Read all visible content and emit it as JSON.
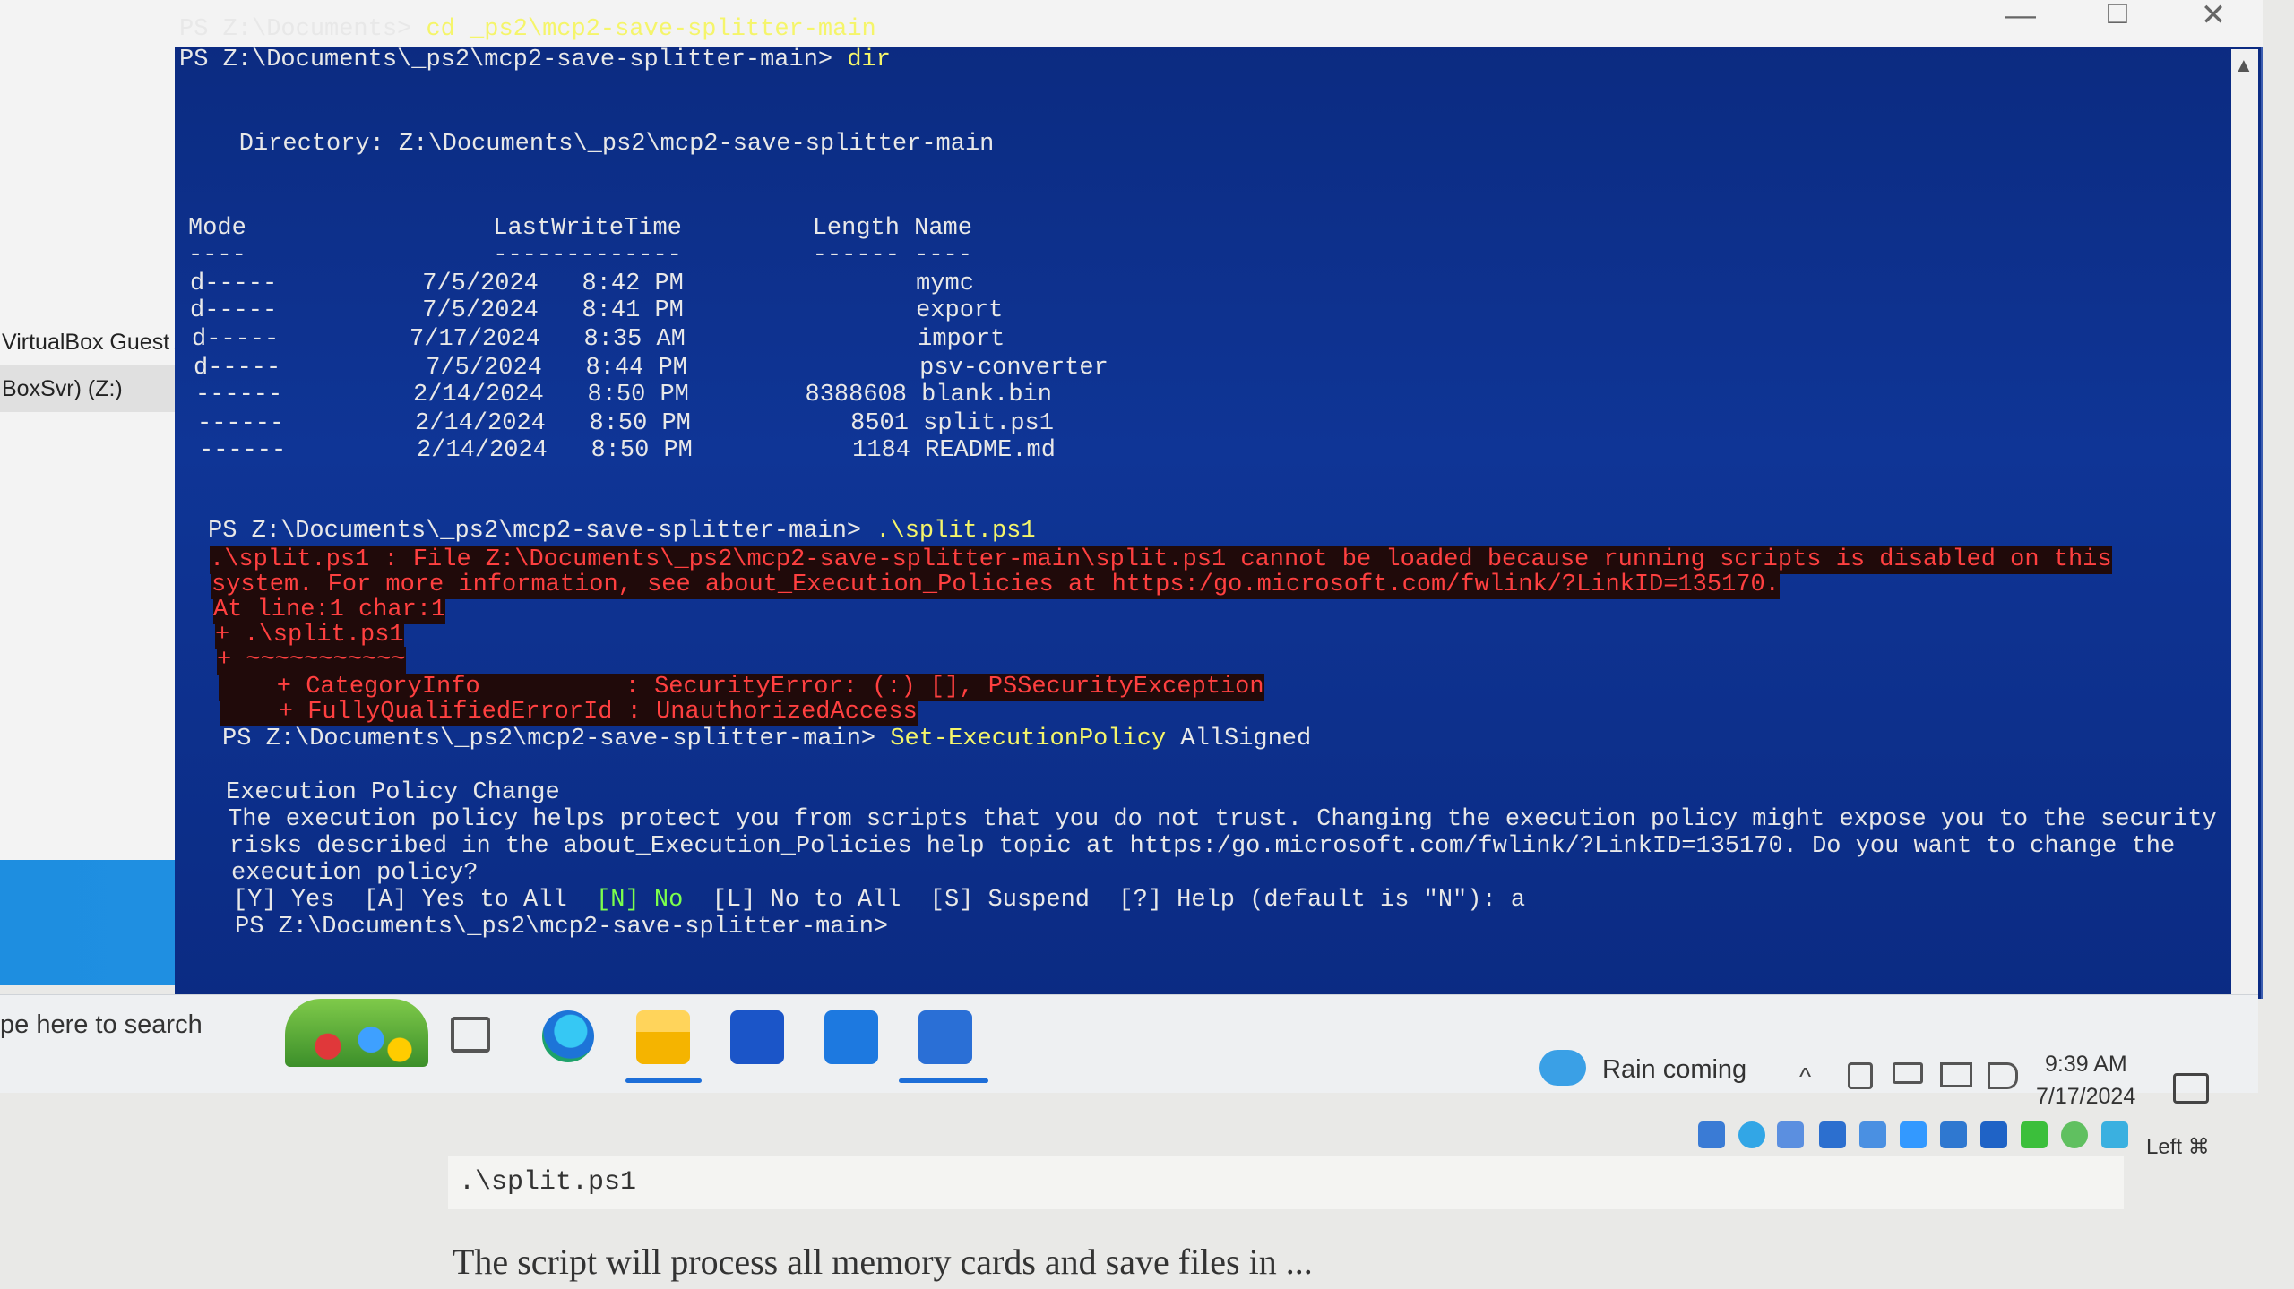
{
  "explorer": {
    "items": [
      "VirtualBox Guest Ac",
      "BoxSvr) (Z:)"
    ]
  },
  "window": {
    "min": "—",
    "max": "☐",
    "close": "✕"
  },
  "console": {
    "lines": [
      {
        "prompt": "PS Z:\\Documents> ",
        "cmd": "cd _ps2\\mcp2-save-splitter-main"
      },
      {
        "prompt": "PS Z:\\Documents\\_ps2\\mcp2-save-splitter-main> ",
        "cmd": "dir"
      },
      {
        "text": "    Directory: Z:\\Documents\\_ps2\\mcp2-save-splitter-main"
      },
      {
        "text": "Mode                 LastWriteTime         Length Name"
      },
      {
        "text": "----                 -------------         ------ ----"
      },
      {
        "text": "d-----          7/5/2024   8:42 PM                mymc"
      },
      {
        "text": "d-----          7/5/2024   8:41 PM                export"
      },
      {
        "text": "d-----         7/17/2024   8:35 AM                import"
      },
      {
        "text": "d-----          7/5/2024   8:44 PM                psv-converter"
      },
      {
        "text": "------         2/14/2024   8:50 PM        8388608 blank.bin"
      },
      {
        "text": "------         2/14/2024   8:50 PM           8501 split.ps1"
      },
      {
        "text": "------         2/14/2024   8:50 PM           1184 README.md"
      },
      {
        "prompt": "PS Z:\\Documents\\_ps2\\mcp2-save-splitter-main> ",
        "cmd": ".\\split.ps1"
      },
      {
        "err": ".\\split.ps1 : File Z:\\Documents\\_ps2\\mcp2-save-splitter-main\\split.ps1 cannot be loaded because running scripts is disabled on this"
      },
      {
        "err": "system. For more information, see about_Execution_Policies at https:/go.microsoft.com/fwlink/?LinkID=135170."
      },
      {
        "err": "At line:1 char:1"
      },
      {
        "err": "+ .\\split.ps1"
      },
      {
        "err": "+ ~~~~~~~~~~~"
      },
      {
        "err": "    + CategoryInfo          : SecurityError: (:) [], PSSecurityException"
      },
      {
        "err": "    + FullyQualifiedErrorId : UnauthorizedAccess"
      },
      {
        "prompt": "PS Z:\\Documents\\_ps2\\mcp2-save-splitter-main> ",
        "cmd": "Set-ExecutionPolicy",
        "arg": " AllSigned"
      },
      {
        "text": "Execution Policy Change"
      },
      {
        "text": "The execution policy helps protect you from scripts that you do not trust. Changing the execution policy might expose you to the security"
      },
      {
        "text": "risks described in the about_Execution_Policies help topic at https:/go.microsoft.com/fwlink/?LinkID=135170. Do you want to change the"
      },
      {
        "text": "execution policy?"
      },
      {
        "opt1": "[Y] Yes  [A] Yes to All  ",
        "opt2": "[N] No",
        "opt3": "  [L] No to All  [S] Suspend  [?] Help (default is \"N\"): a"
      },
      {
        "prompt": "PS Z:\\Documents\\_ps2\\mcp2-save-splitter-main>",
        "cmd": ""
      }
    ]
  },
  "taskbar": {
    "search_placeholder": "pe here to search",
    "weather": "Rain coming",
    "tray_up": "^",
    "time": "9:39 AM",
    "date": "7/17/2024",
    "lang": "Left ⌘"
  },
  "document": {
    "code": ".\\split.ps1",
    "text": "The script will process all memory cards and save files in ..."
  }
}
